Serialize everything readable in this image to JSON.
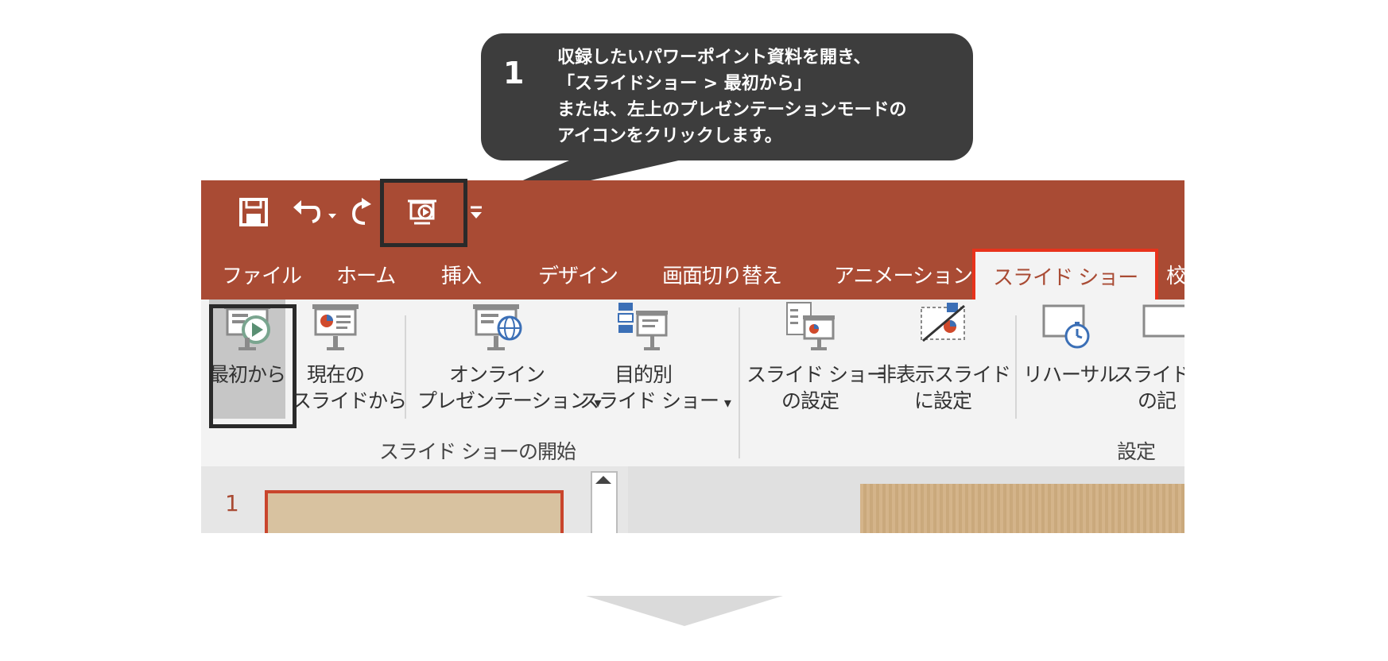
{
  "callout": {
    "step_number": "1",
    "lines": [
      "収録したいパワーポイント資料を開き、",
      "「スライドショー > 最初から」",
      "または、左上のプレゼンテーションモードの",
      "アイコンをクリックします。"
    ]
  },
  "tabs": [
    {
      "label": "ファイル"
    },
    {
      "label": "ホーム"
    },
    {
      "label": "挿入"
    },
    {
      "label": "デザイン"
    },
    {
      "label": "画面切り替え"
    },
    {
      "label": "アニメーション"
    },
    {
      "label": "スライド ショー"
    },
    {
      "label": "校"
    }
  ],
  "ribbon": {
    "from_beginning": {
      "label": "最初から"
    },
    "from_current": {
      "line1": "現在の",
      "line2": "スライドから"
    },
    "online": {
      "line1": "オンライン",
      "line2": "プレゼンテーション"
    },
    "custom": {
      "line1": "目的別",
      "line2": "スライド ショー"
    },
    "setup": {
      "line1": "スライド ショー",
      "line2": "の設定"
    },
    "hide": {
      "line1": "非表示スライド",
      "line2": "に設定"
    },
    "rehearse": {
      "line1": "リハーサル"
    },
    "record": {
      "line1": "スライド",
      "line2": "の記"
    },
    "group_start": "スライド ショーの開始",
    "group_setup": "設定",
    "dropdown_glyph": "▾"
  },
  "slide_pane": {
    "slide_number": "1"
  },
  "colors": {
    "titlebar": "#a94b34",
    "active_tab_border": "#e8331c",
    "callout": "#3d3d3d"
  }
}
